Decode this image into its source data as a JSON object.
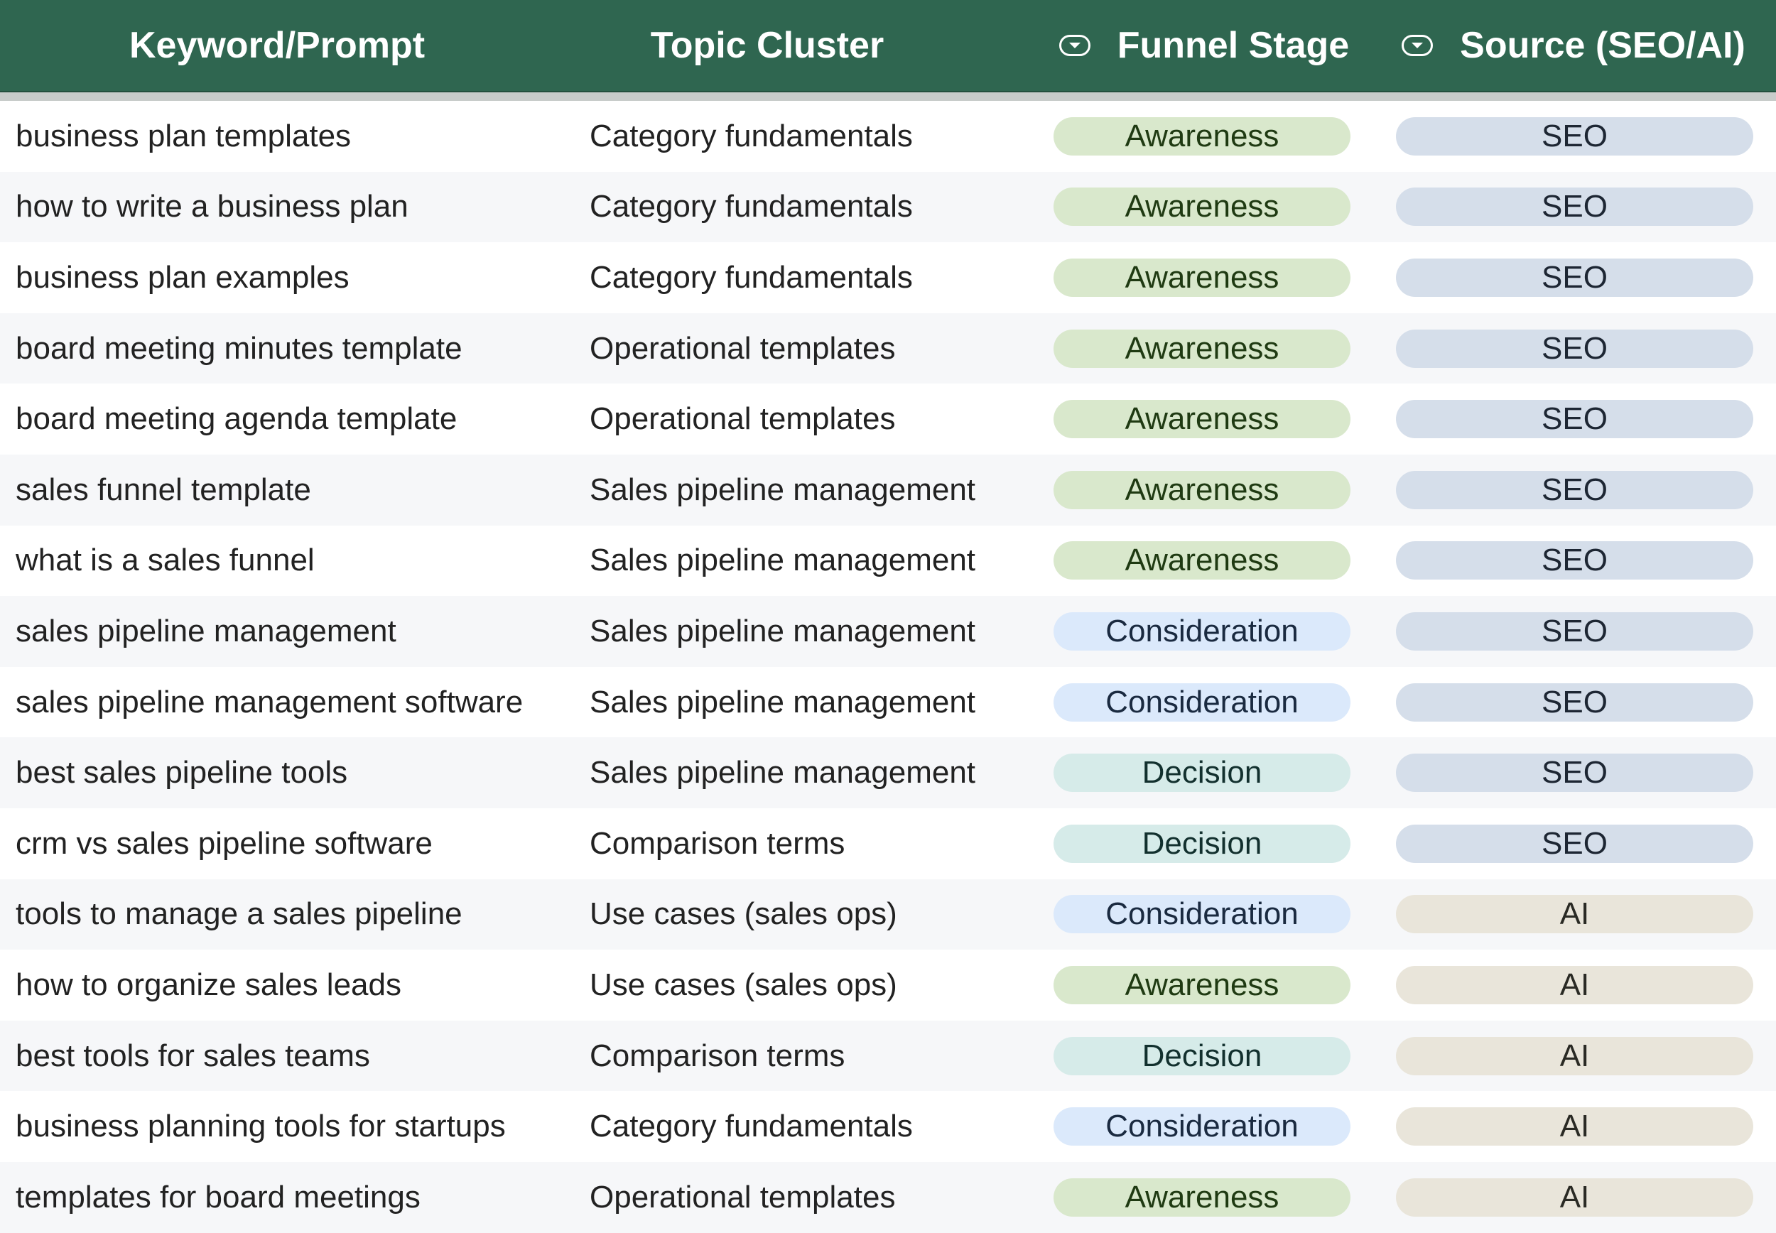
{
  "columns": {
    "keyword": "Keyword/Prompt",
    "topic": "Topic Cluster",
    "stage": "Funnel Stage",
    "source": "Source (SEO/AI)"
  },
  "colors": {
    "header_bg": "#2f6650",
    "awareness": "#d9e8cc",
    "consideration": "#dbe9fb",
    "decision": "#d6ebe9",
    "seo": "#d5deea",
    "ai": "#e9e5da"
  },
  "rows": [
    {
      "keyword": "business plan templates",
      "topic": "Category fundamentals",
      "stage": "Awareness",
      "source": "SEO"
    },
    {
      "keyword": "how to write a business plan",
      "topic": "Category fundamentals",
      "stage": "Awareness",
      "source": "SEO"
    },
    {
      "keyword": "business plan examples",
      "topic": "Category fundamentals",
      "stage": "Awareness",
      "source": "SEO"
    },
    {
      "keyword": "board meeting minutes template",
      "topic": "Operational templates",
      "stage": "Awareness",
      "source": "SEO"
    },
    {
      "keyword": "board meeting agenda template",
      "topic": "Operational templates",
      "stage": "Awareness",
      "source": "SEO"
    },
    {
      "keyword": "sales funnel template",
      "topic": "Sales pipeline management",
      "stage": "Awareness",
      "source": "SEO"
    },
    {
      "keyword": "what is a sales funnel",
      "topic": "Sales pipeline management",
      "stage": "Awareness",
      "source": "SEO"
    },
    {
      "keyword": "sales pipeline management",
      "topic": "Sales pipeline management",
      "stage": "Consideration",
      "source": "SEO"
    },
    {
      "keyword": "sales pipeline management software",
      "topic": "Sales pipeline management",
      "stage": "Consideration",
      "source": "SEO"
    },
    {
      "keyword": "best sales pipeline tools",
      "topic": "Sales pipeline management",
      "stage": "Decision",
      "source": "SEO"
    },
    {
      "keyword": "crm vs sales pipeline software",
      "topic": "Comparison terms",
      "stage": "Decision",
      "source": "SEO"
    },
    {
      "keyword": "tools to manage a sales pipeline",
      "topic": "Use cases (sales ops)",
      "stage": "Consideration",
      "source": "AI"
    },
    {
      "keyword": "how to organize sales leads",
      "topic": "Use cases (sales ops)",
      "stage": "Awareness",
      "source": "AI"
    },
    {
      "keyword": "best tools for sales teams",
      "topic": "Comparison terms",
      "stage": "Decision",
      "source": "AI"
    },
    {
      "keyword": "business planning tools for startups",
      "topic": "Category fundamentals",
      "stage": "Consideration",
      "source": "AI"
    },
    {
      "keyword": "templates for board meetings",
      "topic": "Operational templates",
      "stage": "Awareness",
      "source": "AI"
    }
  ]
}
